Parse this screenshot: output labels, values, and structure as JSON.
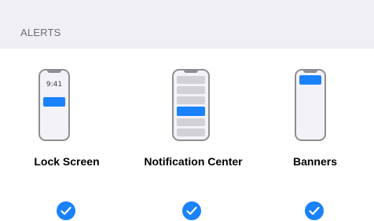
{
  "header": {
    "title": "ALERTS"
  },
  "options": {
    "lock_screen": {
      "label": "Lock Screen",
      "time": "9:41",
      "selected": true
    },
    "notification_center": {
      "label": "Notification Center",
      "selected": true
    },
    "banners": {
      "label": "Banners",
      "selected": true
    }
  },
  "colors": {
    "accent": "#1a82fb",
    "header_bg": "#efeff4",
    "header_text": "#6d6d72",
    "phone_outline": "#8e8e93",
    "placeholder_row": "#d1d1d6"
  },
  "icons": [
    "checkmark-circle-icon"
  ]
}
